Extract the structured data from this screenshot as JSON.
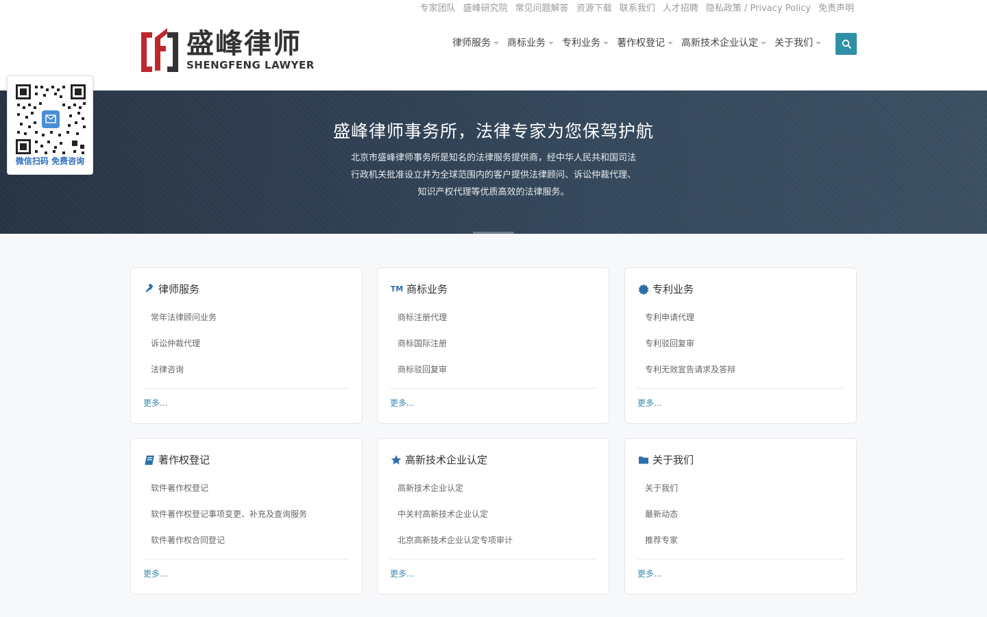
{
  "top_links": [
    "专家团队",
    "盛峰研究院",
    "常见问题解答",
    "资源下载",
    "联系我们",
    "人才招聘",
    "隐私政策 / Privacy Policy",
    "免责声明"
  ],
  "logo": {
    "cn": "盛峰律师",
    "en": "SHENGFENG LAWYER",
    "brand_color": "#c0272d"
  },
  "nav": [
    "律师服务",
    "商标业务",
    "专利业务",
    "著作权登记",
    "高新技术企业认定",
    "关于我们"
  ],
  "search": {
    "icon": "search-icon",
    "color": "#2f8fa6"
  },
  "qr": {
    "caption": "微信扫码 免费咨询"
  },
  "hero": {
    "title": "盛峰律师事务所，法律专家为您保驾护航",
    "desc_lines": [
      "北京市盛峰律师事务所是知名的法律服务提供商，经中华人民共和国司法",
      "行政机关批准设立并为全球范围内的客户提供法律顾问、诉讼仲裁代理、",
      "知识产权代理等优质高效的法律服务。"
    ]
  },
  "cards": [
    {
      "icon": "gavel-icon",
      "title": "律师服务",
      "items": [
        "常年法律顾问业务",
        "诉讼仲裁代理",
        "法律咨询"
      ],
      "more": "更多..."
    },
    {
      "icon": "tm-icon",
      "icon_text": "TM",
      "title": "商标业务",
      "items": [
        "商标注册代理",
        "商标国际注册",
        "商标驳回复审"
      ],
      "more": "更多..."
    },
    {
      "icon": "certificate-icon",
      "title": "专利业务",
      "items": [
        "专利申请代理",
        "专利驳回复审",
        "专利无效宣告请求及答辩"
      ],
      "more": "更多..."
    },
    {
      "icon": "book-icon",
      "title": "著作权登记",
      "items": [
        "软件著作权登记",
        "软件著作权登记事项变更、补充及查询服务",
        "软件著作权合同登记"
      ],
      "more": "更多..."
    },
    {
      "icon": "star-icon",
      "title": "高新技术企业认定",
      "items": [
        "高新技术企业认定",
        "中关村高新技术企业认定",
        "北京高新技术企业认定专项审计"
      ],
      "more": "更多..."
    },
    {
      "icon": "folder-icon",
      "title": "关于我们",
      "items": [
        "关于我们",
        "最新动态",
        "推荐专家"
      ],
      "more": "更多..."
    }
  ]
}
